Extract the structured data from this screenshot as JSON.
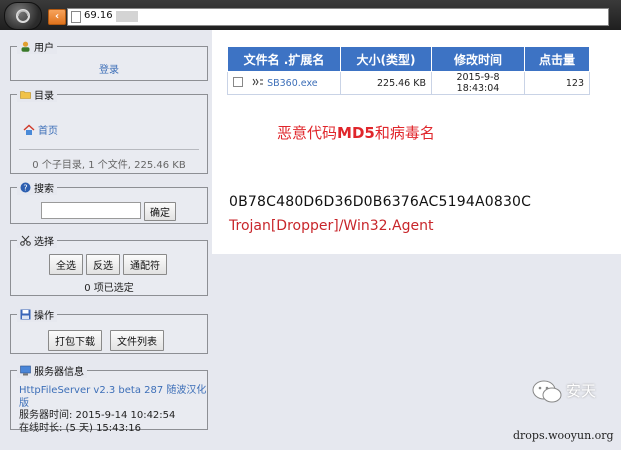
{
  "browser": {
    "url": "69.16"
  },
  "sidebar": {
    "user": {
      "legend": "用户",
      "login_link": "登录"
    },
    "directory": {
      "legend": "目录",
      "home_link": "首页",
      "summary": "0 个子目录, 1 个文件, 225.46 KB"
    },
    "search": {
      "legend": "搜索",
      "input_value": "",
      "submit_label": "确定"
    },
    "select": {
      "legend": "选择",
      "select_all": "全选",
      "invert": "反选",
      "wildcard": "通配符",
      "selected_count": "0 项已选定"
    },
    "actions": {
      "legend": "操作",
      "pack_download": "打包下载",
      "file_list": "文件列表"
    },
    "server_info": {
      "legend": "服务器信息",
      "software_link": "HttpFileServer v2.3 beta 287 随波汉化版",
      "server_time": "服务器时间: 2015-9-14 10:42:54",
      "uptime": "在线时长: (5 天) 15:43:16"
    }
  },
  "file_table": {
    "headers": [
      "文件名 .扩展名",
      "大小(类型)",
      "修改时间",
      "点击量"
    ],
    "rows": [
      {
        "name": "SB360.exe",
        "size": "225.46 KB",
        "modified": "2015-9-8 18:43:04",
        "hits": "123"
      }
    ]
  },
  "annotation": {
    "title_prefix": "恶意代码",
    "title_bold": "MD5",
    "title_suffix": "和病毒名",
    "md5": "0B78C480D6D36D0B6376AC5194A0830C",
    "virus_name": "Trojan[Dropper]/Win32.Agent"
  },
  "watermark": {
    "brand": "安天",
    "site": "drops.wooyun.org"
  },
  "colors": {
    "table_header": "#3d73c4",
    "annotation_red": "#e0262b",
    "link_blue": "#3d6fb8"
  }
}
